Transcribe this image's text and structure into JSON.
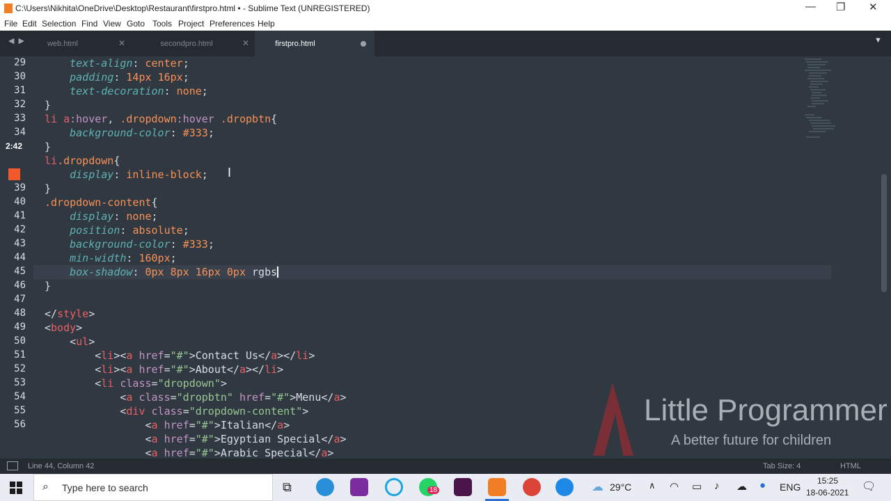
{
  "window": {
    "title": "C:\\Users\\Nikhita\\OneDrive\\Desktop\\Restaurant\\firstpro.html • - Sublime Text (UNREGISTERED)"
  },
  "menu": [
    "File",
    "Edit",
    "Selection",
    "Find",
    "View",
    "Goto",
    "Tools",
    "Project",
    "Preferences",
    "Help"
  ],
  "tabs": [
    {
      "label": "web.html",
      "active": false
    },
    {
      "label": "secondpro.html",
      "active": false
    },
    {
      "label": "firstpro.html",
      "active": true
    }
  ],
  "gutter": {
    "line_numbers": [
      "29",
      "30",
      "31",
      "32",
      "33",
      "34",
      "",
      "",
      "",
      "39",
      "40",
      "41",
      "42",
      "43",
      "44",
      "45",
      "46",
      "47",
      "48",
      "49",
      "50",
      "51",
      "52",
      "53",
      "54",
      "55",
      "56",
      ""
    ],
    "timer": "2:42"
  },
  "code": {
    "lines": [
      [
        {
          "c": "p",
          "t": "    text-align"
        },
        {
          "c": "w",
          "t": ": "
        },
        {
          "c": "v",
          "t": "center"
        },
        {
          "c": "w",
          "t": ";"
        }
      ],
      [
        {
          "c": "p",
          "t": "    padding"
        },
        {
          "c": "w",
          "t": ": "
        },
        {
          "c": "n",
          "t": "14px"
        },
        {
          "c": "w",
          "t": " "
        },
        {
          "c": "n",
          "t": "16px"
        },
        {
          "c": "w",
          "t": ";"
        }
      ],
      [
        {
          "c": "p",
          "t": "    text-decoration"
        },
        {
          "c": "w",
          "t": ": "
        },
        {
          "c": "v",
          "t": "none"
        },
        {
          "c": "w",
          "t": ";"
        }
      ],
      [
        {
          "c": "w",
          "t": "}"
        }
      ],
      [
        {
          "c": "t",
          "t": "li"
        },
        {
          "c": "w",
          "t": " "
        },
        {
          "c": "t",
          "t": "a"
        },
        {
          "c": "a",
          "t": ":hover"
        },
        {
          "c": "w",
          "t": ", "
        },
        {
          "c": "v",
          "t": ".dropdown"
        },
        {
          "c": "a",
          "t": ":hover"
        },
        {
          "c": "w",
          "t": " "
        },
        {
          "c": "v",
          "t": ".dropbtn"
        },
        {
          "c": "w",
          "t": "{"
        }
      ],
      [
        {
          "c": "p",
          "t": "    background-color"
        },
        {
          "c": "w",
          "t": ": "
        },
        {
          "c": "v",
          "t": "#333"
        },
        {
          "c": "w",
          "t": ";"
        }
      ],
      [
        {
          "c": "w",
          "t": "}"
        }
      ],
      [
        {
          "c": "t",
          "t": "li"
        },
        {
          "c": "v",
          "t": ".dropdown"
        },
        {
          "c": "w",
          "t": "{"
        }
      ],
      [
        {
          "c": "p",
          "t": "    display"
        },
        {
          "c": "w",
          "t": ": "
        },
        {
          "c": "v",
          "t": "inline-block"
        },
        {
          "c": "w",
          "t": ";"
        }
      ],
      [
        {
          "c": "w",
          "t": "}"
        }
      ],
      [
        {
          "c": "v",
          "t": ".dropdown-content"
        },
        {
          "c": "w",
          "t": "{"
        }
      ],
      [
        {
          "c": "p",
          "t": "    display"
        },
        {
          "c": "w",
          "t": ": "
        },
        {
          "c": "v",
          "t": "none"
        },
        {
          "c": "w",
          "t": ";"
        }
      ],
      [
        {
          "c": "p",
          "t": "    position"
        },
        {
          "c": "w",
          "t": ": "
        },
        {
          "c": "v",
          "t": "absolute"
        },
        {
          "c": "w",
          "t": ";"
        }
      ],
      [
        {
          "c": "p",
          "t": "    background-color"
        },
        {
          "c": "w",
          "t": ": "
        },
        {
          "c": "v",
          "t": "#333"
        },
        {
          "c": "w",
          "t": ";"
        }
      ],
      [
        {
          "c": "p",
          "t": "    min-width"
        },
        {
          "c": "w",
          "t": ": "
        },
        {
          "c": "n",
          "t": "160px"
        },
        {
          "c": "w",
          "t": ";"
        }
      ],
      [
        {
          "c": "p",
          "t": "    box-shadow"
        },
        {
          "c": "w",
          "t": ": "
        },
        {
          "c": "n",
          "t": "0px"
        },
        {
          "c": "w",
          "t": " "
        },
        {
          "c": "n",
          "t": "8px"
        },
        {
          "c": "w",
          "t": " "
        },
        {
          "c": "n",
          "t": "16px"
        },
        {
          "c": "w",
          "t": " "
        },
        {
          "c": "n",
          "t": "0px"
        },
        {
          "c": "w",
          "t": " rgbs"
        }
      ],
      [
        {
          "c": "w",
          "t": "}"
        }
      ],
      [],
      [
        {
          "c": "w",
          "t": "</"
        },
        {
          "c": "t",
          "t": "style"
        },
        {
          "c": "w",
          "t": ">"
        }
      ],
      [
        {
          "c": "w",
          "t": "<"
        },
        {
          "c": "t",
          "t": "body"
        },
        {
          "c": "w",
          "t": ">"
        }
      ],
      [
        {
          "c": "w",
          "t": "    <"
        },
        {
          "c": "t",
          "t": "ul"
        },
        {
          "c": "w",
          "t": ">"
        }
      ],
      [
        {
          "c": "w",
          "t": "        <"
        },
        {
          "c": "t",
          "t": "li"
        },
        {
          "c": "w",
          "t": "><"
        },
        {
          "c": "t",
          "t": "a"
        },
        {
          "c": "a",
          "t": " href"
        },
        {
          "c": "w",
          "t": "="
        },
        {
          "c": "s",
          "t": "\"#\""
        },
        {
          "c": "w",
          "t": ">Contact Us</"
        },
        {
          "c": "t",
          "t": "a"
        },
        {
          "c": "w",
          "t": "></"
        },
        {
          "c": "t",
          "t": "li"
        },
        {
          "c": "w",
          "t": ">"
        }
      ],
      [
        {
          "c": "w",
          "t": "        <"
        },
        {
          "c": "t",
          "t": "li"
        },
        {
          "c": "w",
          "t": "><"
        },
        {
          "c": "t",
          "t": "a"
        },
        {
          "c": "a",
          "t": " href"
        },
        {
          "c": "w",
          "t": "="
        },
        {
          "c": "s",
          "t": "\"#\""
        },
        {
          "c": "w",
          "t": ">About</"
        },
        {
          "c": "t",
          "t": "a"
        },
        {
          "c": "w",
          "t": "></"
        },
        {
          "c": "t",
          "t": "li"
        },
        {
          "c": "w",
          "t": ">"
        }
      ],
      [
        {
          "c": "w",
          "t": "        <"
        },
        {
          "c": "t",
          "t": "li"
        },
        {
          "c": "a",
          "t": " class"
        },
        {
          "c": "w",
          "t": "="
        },
        {
          "c": "s",
          "t": "\"dropdown\""
        },
        {
          "c": "w",
          "t": ">"
        }
      ],
      [
        {
          "c": "w",
          "t": "            <"
        },
        {
          "c": "t",
          "t": "a"
        },
        {
          "c": "a",
          "t": " class"
        },
        {
          "c": "w",
          "t": "="
        },
        {
          "c": "s",
          "t": "\"dropbtn\""
        },
        {
          "c": "a",
          "t": " href"
        },
        {
          "c": "w",
          "t": "="
        },
        {
          "c": "s",
          "t": "\"#\""
        },
        {
          "c": "w",
          "t": ">Menu</"
        },
        {
          "c": "t",
          "t": "a"
        },
        {
          "c": "w",
          "t": ">"
        }
      ],
      [
        {
          "c": "w",
          "t": "            <"
        },
        {
          "c": "t",
          "t": "div"
        },
        {
          "c": "a",
          "t": " class"
        },
        {
          "c": "w",
          "t": "="
        },
        {
          "c": "s",
          "t": "\"dropdown-content\""
        },
        {
          "c": "w",
          "t": ">"
        }
      ],
      [
        {
          "c": "w",
          "t": "                <"
        },
        {
          "c": "t",
          "t": "a"
        },
        {
          "c": "a",
          "t": " href"
        },
        {
          "c": "w",
          "t": "="
        },
        {
          "c": "s",
          "t": "\"#\""
        },
        {
          "c": "w",
          "t": ">Italian</"
        },
        {
          "c": "t",
          "t": "a"
        },
        {
          "c": "w",
          "t": ">"
        }
      ],
      [
        {
          "c": "w",
          "t": "                <"
        },
        {
          "c": "t",
          "t": "a"
        },
        {
          "c": "a",
          "t": " href"
        },
        {
          "c": "w",
          "t": "="
        },
        {
          "c": "s",
          "t": "\"#\""
        },
        {
          "c": "w",
          "t": ">Egyptian Special</"
        },
        {
          "c": "t",
          "t": "a"
        },
        {
          "c": "w",
          "t": ">"
        }
      ],
      [
        {
          "c": "w",
          "t": "                <"
        },
        {
          "c": "t",
          "t": "a"
        },
        {
          "c": "a",
          "t": " href"
        },
        {
          "c": "w",
          "t": "="
        },
        {
          "c": "s",
          "t": "\"#\""
        },
        {
          "c": "w",
          "t": ">Arabic Special</"
        },
        {
          "c": "t",
          "t": "a"
        },
        {
          "c": "w",
          "t": ">"
        }
      ]
    ]
  },
  "status": {
    "position": "Line 44, Column 42",
    "tab_size": "Tab Size: 4",
    "syntax": "HTML"
  },
  "watermark": {
    "title": "Little Programmer",
    "subtitle": "A better future for children"
  },
  "taskbar": {
    "search_placeholder": "Type here to search",
    "weather": "29°C",
    "language": "ENG",
    "time": "15:25",
    "date": "18-06-2021",
    "whatsapp_badge": "18"
  },
  "colors": {
    "editor_bg": "#303841",
    "tab_bar": "#252b31",
    "keyword": "#ec5f66",
    "property": "#5fb3b3",
    "value": "#f99157",
    "string": "#99c794",
    "attribute": "#c594c5"
  }
}
